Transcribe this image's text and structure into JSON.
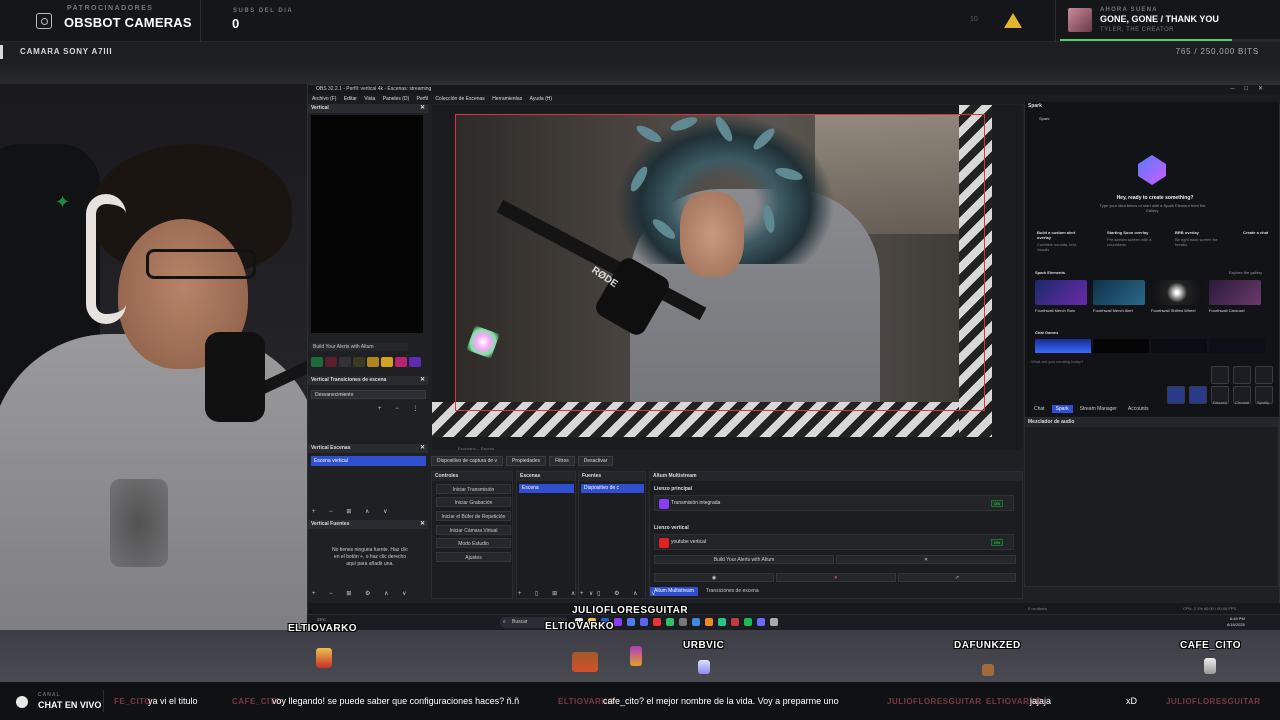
{
  "topbar": {
    "sponsor_small": "PATROCINADORES",
    "sponsor_name": "OBSBOT CAMERAS",
    "subs_small": "SUBS DEL DIA",
    "subs_count": "0",
    "goal_value": "10",
    "now_playing_small": "AHORA SUENA",
    "song_title": "GONE, GONE / THANK YOU",
    "song_artist": "TYLER, THE CREATOR",
    "song_progress": 0.78
  },
  "camera_strip": {
    "label": "CAMARA SONY A7III",
    "bits": "765 / 250,000 BITS"
  },
  "obs": {
    "title": "OBS 32.2.1 - Perfil: vertical 4k - Escenas: streaming",
    "menu": [
      "Archivo (F)",
      "Editar",
      "Vista",
      "Paneles (D)",
      "Perfil",
      "Colección de Escenas",
      "Herramientas",
      "Ayuda (H)"
    ],
    "vertical_dock": "Vertical",
    "alerts_item": "Build Your Alerts with Altum",
    "transitions_dock": "Vertical Transiciones de escena",
    "transition_value": "Desvanecimiento",
    "scenes_dock": "Vertical Escenas",
    "scene_selected": "Escena vertical",
    "sources_dock": "Vertical Fuentes",
    "no_sources_text": "No tienes ninguna fuente. Haz clic en el botón +, o haz clic derecho aquí para añadir una.",
    "canvas_status": "Escenario -- Escena",
    "source_buttons": [
      "Dispositivo de captura de v",
      "Propiedades",
      "Filtros",
      "Desactivar"
    ],
    "panels": {
      "controls": "Controles",
      "scenes": "Escenas",
      "sources": "Fuentes",
      "multistream": "Altum Multistream"
    },
    "controls": [
      "Iniciar Transmisión",
      "Iniciar Grabación",
      "Iniciar el Búfer de Repetición",
      "Iniciar Cámara Virtual",
      "Modo Estudio",
      "Ajustes"
    ],
    "scene_item": "Escena",
    "source_item": "Dispositivo de c",
    "multistream": {
      "canvas_main": "Lienzo principal",
      "canvas_main_row": "Transmisión integrada",
      "canvas_vertical": "Lienzo vertical",
      "canvas_vertical_row": "youtube vertical",
      "on_label": "ON",
      "alerts_btn": "Build Your Alerts with Altum",
      "tab_active": "Altum Multistream",
      "tab_other": "Transiciones de escena"
    },
    "status_left": "0 ocultos/s",
    "status_right": "CPU: 2.1%   60.00 / 60.00 FPS"
  },
  "spark": {
    "title": "Spark",
    "sub": "Spark",
    "greeting": "Hey, ready to create something?",
    "desc": "Type your idea below or start with a Spark Element from the Gallery.",
    "suggestions": [
      {
        "title": "Build a custom alert overlay",
        "desc": "Combine sounds, text, visuals"
      },
      {
        "title": "Starting Soon overlay",
        "desc": "Pre-stream screen with a countdown"
      },
      {
        "title": "BRB overlay",
        "desc": "Be right back screen for breaks"
      },
      {
        "title": "Create a chat",
        "desc": ""
      }
    ],
    "elements_header": "Spark Elements",
    "explore": "Explore the gallery",
    "elements": [
      "Fourthwall Merch Rain",
      "Fourthwall Merch Alert",
      "Fourthwall Shifted Wheel",
      "Fourthwall Carousel"
    ],
    "chat_games": "Chat Games",
    "input_placeholder": "What are you creating today?",
    "tabs": [
      "Chat",
      "Spark",
      "Stream Manager",
      "Accounts"
    ],
    "hud_labels": [
      "Discord",
      "Chrome",
      "Spotify"
    ]
  },
  "mixer_title": "Mezclador de audio",
  "taskbar": {
    "weather": "23°C",
    "search": "Buscar",
    "time": "6:49 PM",
    "date": "6/16/2025"
  },
  "stage": {
    "users": [
      "ELTIOVARKO",
      "JULIOFLORESGUITAR",
      "ELTIOVARKO",
      "URBVIC",
      "DAFUNKZED",
      "CAFE_CITO"
    ]
  },
  "ticker": {
    "small": "CANAL",
    "label": "CHAT EN VIVO",
    "messages": [
      {
        "user": "FE_CITO",
        "text": "ya vi el titulo"
      },
      {
        "user": "CAFE_CITO",
        "text": "voy llegando! se puede saber que configuraciones haces? ñ.ñ"
      },
      {
        "user": "ELTIOVARKO",
        "text": "cafe_cito? el mejor nombre de la vida. Voy a preparme uno"
      },
      {
        "user": "JULIOFLORESGUITAR",
        "text": ""
      },
      {
        "user": "ELTIOVARKO",
        "text": "jajaja"
      },
      {
        "user": "",
        "text": "xD"
      },
      {
        "user": "JULIOFLORESGUITAR",
        "text": ""
      }
    ]
  },
  "colors": {
    "accent_blue": "#2f4fcf",
    "spotify_green": "#4fd06a",
    "twitch": "#8a3cf2",
    "youtube": "#e32121",
    "triforce": "#e3b52a",
    "preview_outline": "#e0303b"
  },
  "icons": [
    "sponsor-icon",
    "triforce-icon",
    "album-art",
    "razer-logo",
    "twitch-icon",
    "youtube-icon",
    "spark-logo",
    "search-icon",
    "chat-icon"
  ]
}
